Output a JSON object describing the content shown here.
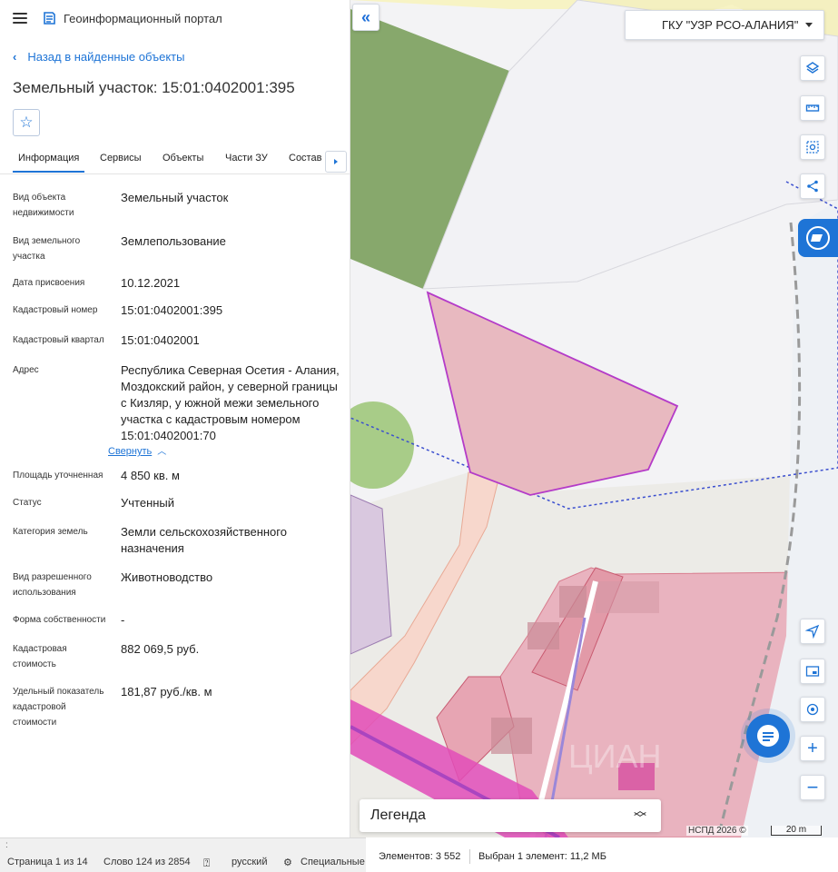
{
  "portal": {
    "title": "Геоинформационный портал"
  },
  "nav": {
    "back_label": "Назад в найденные объекты"
  },
  "object": {
    "title": "Земельный участок: 15:01:0402001:395"
  },
  "tabs": [
    {
      "label": "Информация"
    },
    {
      "label": "Сервисы"
    },
    {
      "label": "Объекты"
    },
    {
      "label": "Части ЗУ"
    },
    {
      "label": "Состав"
    }
  ],
  "attributes": [
    {
      "label": "Вид объекта недвижимости",
      "value": "Земельный участок"
    },
    {
      "label": "Вид земельного участка",
      "value": "Землепользование"
    },
    {
      "label": "Дата присвоения",
      "value": "10.12.2021"
    },
    {
      "label": "Кадастровый номер",
      "value": "15:01:0402001:395"
    },
    {
      "label": "Кадастровый квартал",
      "value": "15:01:0402001"
    },
    {
      "label": "Адрес",
      "value": "Республика Северная Осетия - Алания, Моздокский район, у северной границы с Кизляр, у южной межи земельного участка с кадастровым номером 15:01:0402001:70"
    },
    {
      "label": "Площадь уточненная",
      "value": "4 850 кв. м"
    },
    {
      "label": "Статус",
      "value": "Учтенный"
    },
    {
      "label": "Категория земель",
      "value": "Земли сельскохозяйственного назначения"
    },
    {
      "label": "Вид разрешенного использования",
      "value": "Животноводство"
    },
    {
      "label": "Форма собственности",
      "value": "-"
    },
    {
      "label": "Кадастровая стоимость",
      "value": "882 069,5 руб."
    },
    {
      "label": "Удельный показатель кадастровой стоимости",
      "value": "181,87 руб./кв. м"
    }
  ],
  "address_collapse_label": "Свернуть",
  "map": {
    "org_select": "ГКУ \"УЗР РСО-АЛАНИЯ\"",
    "legend_label": "Легенда",
    "attribution": "НСПД 2026 ©",
    "scale_label": "20 m",
    "watermark": "ЦИАН",
    "colors": {
      "accent": "#1e74d6",
      "selected_parcel_fill": "#e8b9c0",
      "selected_parcel_stroke": "#b43bc8"
    }
  },
  "statusbar": {
    "page": "Страница 1 из 14",
    "words": "Слово 124 из 2854",
    "language": "русский",
    "special": "Специальные",
    "elements": "Элементов: 3 552",
    "selection": "Выбран 1 элемент: 11,2 МБ"
  },
  "icons": [
    "hamburger-icon",
    "portal-logo-icon",
    "chevron-left-icon",
    "star-icon",
    "double-chevron-left-icon",
    "layers-icon",
    "ruler-icon",
    "select-area-icon",
    "share-icon",
    "nspd-icon",
    "navigate-icon",
    "minimap-icon",
    "locate-icon",
    "zoom-in-icon",
    "zoom-out-icon",
    "chat-icon"
  ]
}
